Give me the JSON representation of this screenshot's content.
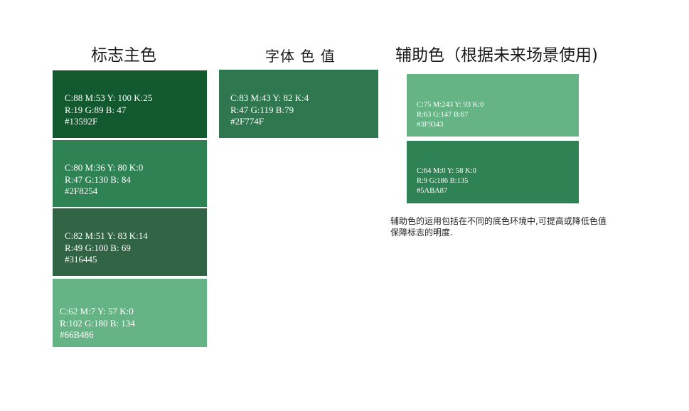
{
  "titles": {
    "main": "标志主色",
    "font": "字体 色 值",
    "aux": "辅助色（根据未来场景使用)"
  },
  "main_colors": [
    {
      "cmyk": "C:88  M:53 Y: 100 K:25",
      "rgb": "R:19  G:89 B: 47",
      "hex": "#13592F",
      "color": "#13592F"
    },
    {
      "cmyk": "C:80  M:36 Y: 80 K:0",
      "rgb": "R:47  G:130 B: 84",
      "hex": "#2F8254",
      "color": "#2F8254"
    },
    {
      "cmyk": "C:82  M:51 Y: 83 K:14",
      "rgb": "R:49  G:100 B: 69",
      "hex": "#316445",
      "color": "#316445"
    },
    {
      "cmyk": "C:62  M:7 Y: 57 K:0",
      "rgb": "R:102  G:180 B: 134",
      "hex": "#66B486",
      "color": "#66B486"
    }
  ],
  "font_color": {
    "cmyk": "C:83   M:43  Y: 82  K:4",
    "rgb": "R:47  G:119  B:79",
    "hex": "#2F774F",
    "color": "#2F774F"
  },
  "aux_colors": [
    {
      "cmyk": "C:75   M:243  Y: 93  K:0",
      "rgb": "R:63  G:147  B:67",
      "hex": "#3F9343",
      "color": "#66B486"
    },
    {
      "cmyk": "C:64   M:0  Y: 58  K:0",
      "rgb": "R:9  G:186  B:135",
      "hex": "#5ABA87",
      "color": "#2F8254"
    }
  ],
  "note": {
    "line1": "辅助色的运用包括在不同的底色环境中,可提高或降低色值",
    "line2": "保障标志的明度."
  }
}
